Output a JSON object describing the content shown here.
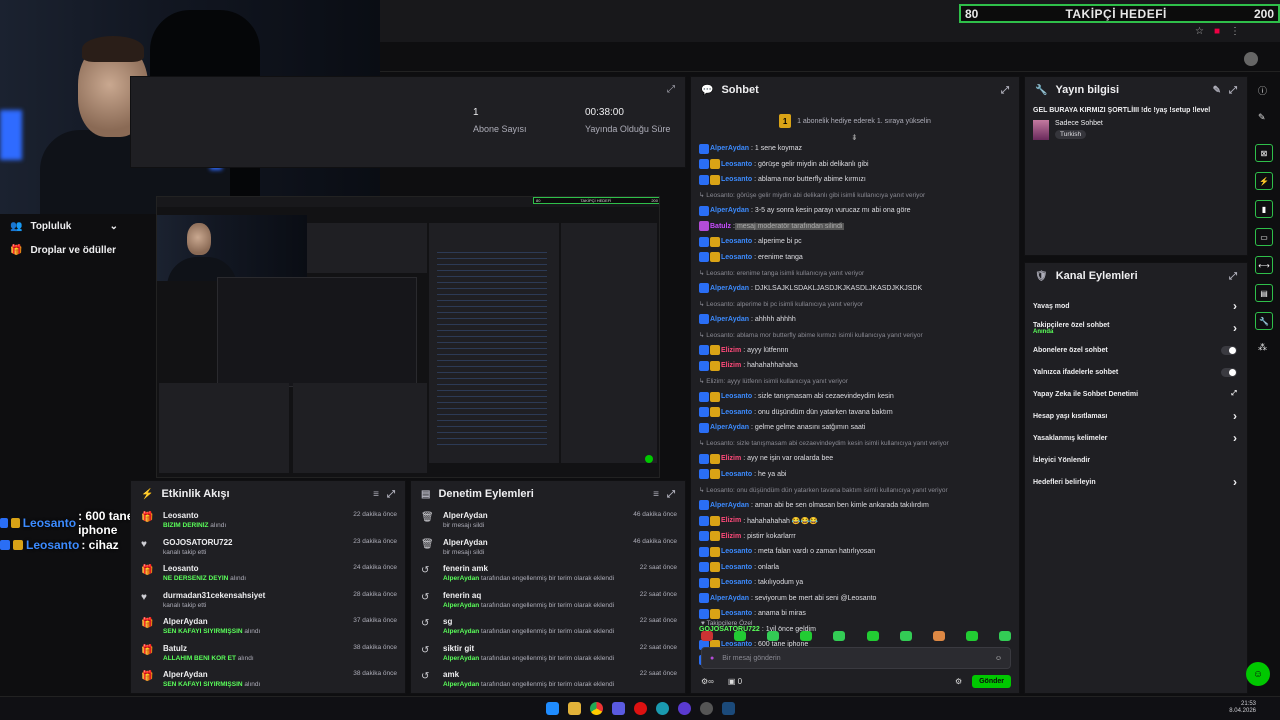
{
  "goal": {
    "left": "80",
    "title": "TAKİPÇİ HEDEFİ",
    "right": "200"
  },
  "left_nav": [
    {
      "icon": "people-icon",
      "label": "Topluluk"
    },
    {
      "icon": "gift-icon",
      "label": "Droplar ve ödüller"
    }
  ],
  "overlay_chat": [
    {
      "user": "Leosanto",
      "text": ": 600 tane iphone"
    },
    {
      "user": "Leosanto",
      "text": ": cihaz"
    }
  ],
  "stats": [
    {
      "value": "1",
      "label": "Abone Sayısı"
    },
    {
      "value": "00:38:00",
      "label": "Yayında Olduğu Süre"
    }
  ],
  "feed": {
    "title": "Etkinlik Akışı",
    "items": [
      {
        "icon": "gift",
        "name": "Leosanto",
        "desc": "",
        "green": "BİZİM DERİNİZ",
        "tail": " alındı",
        "time": "22 dakika önce"
      },
      {
        "icon": "heart",
        "name": "GOJOSATORU722",
        "desc": "kanalı takip etti",
        "green": "",
        "tail": "",
        "time": "23 dakika önce"
      },
      {
        "icon": "gift",
        "name": "Leosanto",
        "desc": "",
        "green": "NE DERSENİZ DEYİN",
        "tail": " alındı",
        "time": "24 dakika önce"
      },
      {
        "icon": "heart",
        "name": "durmadan31cekensahsiyet",
        "desc": "kanalı takip etti",
        "green": "",
        "tail": "",
        "time": "28 dakika önce"
      },
      {
        "icon": "gift",
        "name": "AlperAydan",
        "desc": "",
        "green": "SEN KAFAYI SIYIRMIŞSIN",
        "tail": " alındı",
        "time": "37 dakika önce"
      },
      {
        "icon": "gift",
        "name": "Batulz",
        "desc": "",
        "green": "ALLAHIM BENİ KÖR ET",
        "tail": " alındı",
        "time": "38 dakika önce"
      },
      {
        "icon": "gift",
        "name": "AlperAydan",
        "desc": "",
        "green": "SEN KAFAYI SIYIRMIŞSIN",
        "tail": " alındı",
        "time": "38 dakika önce"
      }
    ]
  },
  "mod": {
    "title": "Denetim Eylemleri",
    "items": [
      {
        "icon": "trash",
        "name": "AlperAydan",
        "desc": "bir mesajı sildi",
        "green": "",
        "tail": "",
        "time": "46 dakika önce"
      },
      {
        "icon": "trash",
        "name": "AlperAydan",
        "desc": "bir mesajı sildi",
        "green": "",
        "tail": "",
        "time": "46 dakika önce"
      },
      {
        "icon": "undo",
        "name": "fenerin amk",
        "desc": "",
        "green": "AlperAydan",
        "tail": " tarafından engellenmiş bir terim olarak eklendi",
        "time": "22 saat önce"
      },
      {
        "icon": "undo",
        "name": "fenerin aq",
        "desc": "",
        "green": "AlperAydan",
        "tail": " tarafından engellenmiş bir terim olarak eklendi",
        "time": "22 saat önce"
      },
      {
        "icon": "undo",
        "name": "sg",
        "desc": "",
        "green": "AlperAydan",
        "tail": " tarafından engellenmiş bir terim olarak eklendi",
        "time": "22 saat önce"
      },
      {
        "icon": "undo",
        "name": "siktir git",
        "desc": "",
        "green": "AlperAydan",
        "tail": " tarafından engellenmiş bir terim olarak eklendi",
        "time": "22 saat önce"
      },
      {
        "icon": "undo",
        "name": "amk",
        "desc": "",
        "green": "AlperAydan",
        "tail": " tarafından engellenmiş bir terim olarak eklendi",
        "time": "22 saat önce"
      }
    ]
  },
  "chat": {
    "title": "Sohbet",
    "pinned": "1 abonelik hediye ederek 1. sıraya yükselin",
    "messages": [
      {
        "user": "AlperAydan",
        "color": "#3c8bff",
        "badges": [
          "blue"
        ],
        "text": ": 1 sene koymaz"
      },
      {
        "user": "Leosanto",
        "color": "#3c8bff",
        "badges": [
          "blue",
          "gold"
        ],
        "text": ": görüşe gelir miydin abi delikanlı gibi"
      },
      {
        "user": "Leosanto",
        "color": "#3c8bff",
        "badges": [
          "blue",
          "gold"
        ],
        "text": ": ablama mor butterfly abime kırmızı"
      },
      {
        "reply": "Leosanto: görüşe gelir miydin abi delikanlı gibi isimli kullanıcıya yanıt veriyor"
      },
      {
        "user": "AlperAydan",
        "color": "#3c8bff",
        "badges": [
          "blue"
        ],
        "text": ": 3-5 ay sonra kesin parayı vurucaz mı abi ona göre"
      },
      {
        "user": "Batulz",
        "color": "#c84cff",
        "badges": [
          "pink"
        ],
        "text": ":",
        "hl": "mesaj moderatör tarafından silindi"
      },
      {
        "user": "Leosanto",
        "color": "#3c8bff",
        "badges": [
          "blue",
          "gold"
        ],
        "text": ": alperime bi pc"
      },
      {
        "user": "Leosanto",
        "color": "#3c8bff",
        "badges": [
          "blue",
          "gold"
        ],
        "text": ": erenime tanga"
      },
      {
        "reply": "Leosanto: erenime tanga isimli kullanıcıya yanıt veriyor"
      },
      {
        "user": "AlperAydan",
        "color": "#3c8bff",
        "badges": [
          "blue"
        ],
        "text": ": DJKLSAJKLSDAKLJASDJKJKASDLJKASDJKKJSDK"
      },
      {
        "reply": "Leosanto: alperime bi pc isimli kullanıcıya yanıt veriyor"
      },
      {
        "user": "AlperAydan",
        "color": "#3c8bff",
        "badges": [
          "blue"
        ],
        "text": ": ahhhh ahhhh"
      },
      {
        "reply": "Leosanto: ablama mor butterfly abime kırmızı isimli kullanıcıya yanıt veriyor"
      },
      {
        "user": "Elizim",
        "color": "#ff4a7a",
        "badges": [
          "blue",
          "gold"
        ],
        "text": ": ayyy lütfennn"
      },
      {
        "user": "Elizim",
        "color": "#ff4a7a",
        "badges": [
          "blue",
          "gold"
        ],
        "text": ": hahahahhahaha"
      },
      {
        "reply": "Elizim: ayyy lütfenn isimli kullanıcıya yanıt veriyor"
      },
      {
        "user": "Leosanto",
        "color": "#3c8bff",
        "badges": [
          "blue",
          "gold"
        ],
        "text": ": sizle tanışmasam abi cezaevindeydim kesin"
      },
      {
        "user": "Leosanto",
        "color": "#3c8bff",
        "badges": [
          "blue",
          "gold"
        ],
        "text": ": onu düşündüm dün yatarken tavana baktım"
      },
      {
        "user": "AlperAydan",
        "color": "#3c8bff",
        "badges": [
          "blue"
        ],
        "text": ": gelme gelme anasını satğımın saati"
      },
      {
        "reply": "Leosanto: sizle tanışmasam abi cezaevindeydim kesin isimli kullanıcıya yanıt veriyor"
      },
      {
        "user": "Elizim",
        "color": "#ff4a7a",
        "badges": [
          "blue",
          "gold"
        ],
        "text": ": ayy ne işin var oralarda bee"
      },
      {
        "user": "Leosanto",
        "color": "#3c8bff",
        "badges": [
          "blue",
          "gold"
        ],
        "text": ": he ya abi"
      },
      {
        "reply": "Leosanto: onu düşündüm dün yatarken tavana baktım isimli kullanıcıya yanıt veriyor"
      },
      {
        "user": "AlperAydan",
        "color": "#3c8bff",
        "badges": [
          "blue"
        ],
        "text": ": aman abi be sen olmasan ben kimle ankarada takılırdım"
      },
      {
        "user": "Elizim",
        "color": "#ff4a7a",
        "badges": [
          "blue",
          "gold"
        ],
        "text": ": hahahahahah 😂😂😂"
      },
      {
        "user": "Elizim",
        "color": "#ff4a7a",
        "badges": [
          "blue",
          "gold"
        ],
        "text": ": pistirr kokarlarrr"
      },
      {
        "user": "Leosanto",
        "color": "#3c8bff",
        "badges": [
          "blue",
          "gold"
        ],
        "text": ": meta falan vardı o zaman hatırlıyosan"
      },
      {
        "user": "Leosanto",
        "color": "#3c8bff",
        "badges": [
          "blue",
          "gold"
        ],
        "text": ": onlarla"
      },
      {
        "user": "Leosanto",
        "color": "#3c8bff",
        "badges": [
          "blue",
          "gold"
        ],
        "text": ": takılıyodum ya"
      },
      {
        "user": "AlperAydan",
        "color": "#3c8bff",
        "badges": [
          "blue"
        ],
        "text": ": seviyorum be mert abi seni @Leosanto"
      },
      {
        "user": "Leosanto",
        "color": "#3c8bff",
        "badges": [
          "blue",
          "gold"
        ],
        "text": ": anama bi miras"
      },
      {
        "user": "GOJOSATORU722",
        "color": "#5aff5a",
        "badges": [],
        "text": ": 1yil önce geldim"
      },
      {
        "user": "Leosanto",
        "color": "#3c8bff",
        "badges": [
          "blue",
          "gold"
        ],
        "text": ": 600 tane iphone"
      },
      {
        "user": "Leosanto",
        "color": "#3c8bff",
        "badges": [
          "blue",
          "gold"
        ],
        "text": ": cihaz"
      }
    ],
    "follow_only": "Takipçilere Özel",
    "input_placeholder": "Bir mesaj gönderin",
    "viewer_count": "0",
    "send_label": "Gönder"
  },
  "info": {
    "title": "Yayın bilgisi",
    "stream_title": "GEL BURAYA KIRMIZI ŞORTLİIII !dc !yaş !setup !level",
    "category": "Sadece Sohbet",
    "language": "Turkish"
  },
  "actions": {
    "title": "Kanal Eylemleri",
    "rows": [
      {
        "label": "Yavaş mod",
        "sub": "",
        "ctl": "chevron"
      },
      {
        "label": "Takipçilere özel sohbet",
        "sub": "Anında",
        "ctl": "chevron"
      },
      {
        "label": "Abonelere özel sohbet",
        "sub": "",
        "ctl": "toggle"
      },
      {
        "label": "Yalnızca ifadelerle sohbet",
        "sub": "",
        "ctl": "toggle"
      },
      {
        "label": "Yapay Zeka ile Sohbet Denetimi",
        "sub": "",
        "ctl": "external"
      },
      {
        "label": "Hesap yaşı kısıtlaması",
        "sub": "",
        "ctl": "chevron"
      },
      {
        "label": "Yasaklanmış kelimeler",
        "sub": "",
        "ctl": "chevron"
      },
      {
        "label": "İzleyici Yönlendir",
        "sub": "",
        "ctl": ""
      },
      {
        "label": "Hedefleri belirleyin",
        "sub": "",
        "ctl": "chevron"
      }
    ]
  },
  "nested": {
    "goal_left": "80",
    "goal_title": "TAKİPÇİ HEDEFİ",
    "goal_right": "200"
  },
  "clock": {
    "time": "21:53",
    "date": "8.04.2026"
  }
}
